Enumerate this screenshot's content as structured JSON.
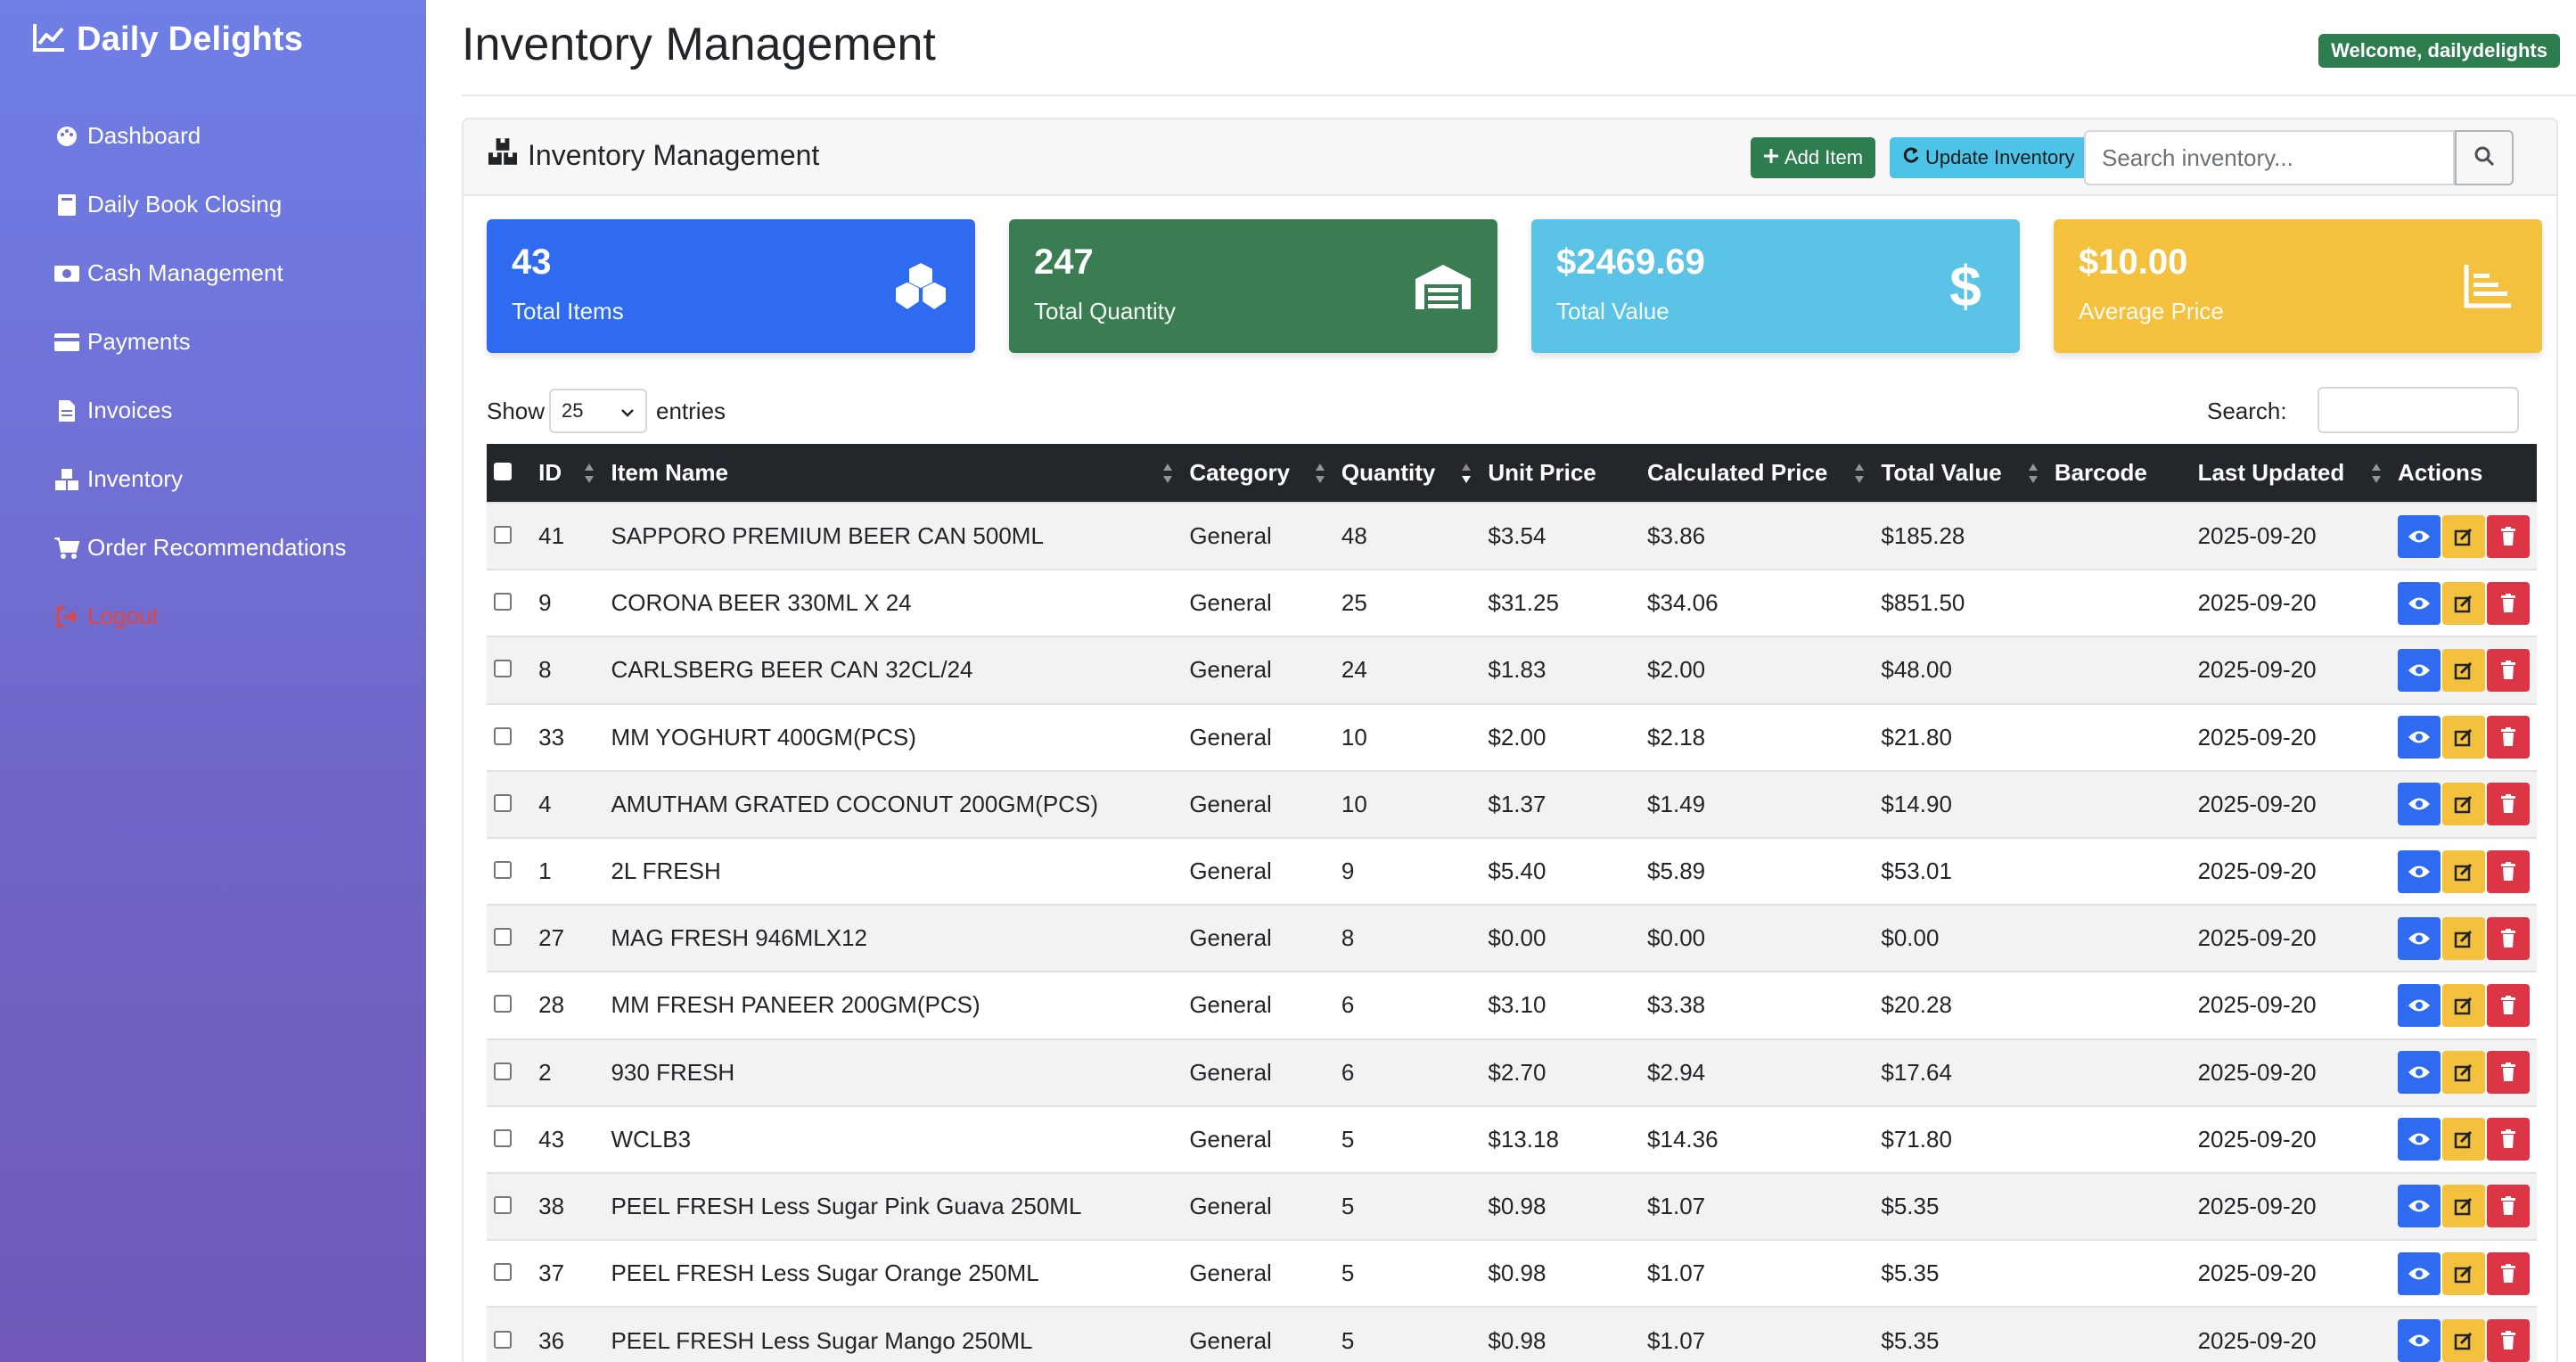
{
  "sidebar": {
    "brand": "Daily Delights",
    "items": [
      {
        "label": "Dashboard",
        "icon": "palette-icon"
      },
      {
        "label": "Daily Book Closing",
        "icon": "book-icon"
      },
      {
        "label": "Cash Management",
        "icon": "money-icon"
      },
      {
        "label": "Payments",
        "icon": "credit-card-icon"
      },
      {
        "label": "Invoices",
        "icon": "invoice-icon"
      },
      {
        "label": "Inventory",
        "icon": "boxes-icon"
      },
      {
        "label": "Order Recommendations",
        "icon": "cart-icon"
      },
      {
        "label": "Logout",
        "icon": "logout-icon"
      }
    ]
  },
  "header": {
    "title": "Inventory Management",
    "welcome": "Welcome, dailydelights"
  },
  "card": {
    "title": "Inventory Management",
    "add_label": "Add Item",
    "update_label": "Update Inventory",
    "search_placeholder": "Search inventory..."
  },
  "stats": [
    {
      "value": "43",
      "label": "Total Items",
      "color": "#2f6bf0",
      "icon": "boxes-icon"
    },
    {
      "value": "247",
      "label": "Total Quantity",
      "color": "#3b7d52",
      "icon": "warehouse-icon"
    },
    {
      "value": "$2469.69",
      "label": "Total Value",
      "color": "#5bc3e6",
      "icon": "dollar-icon"
    },
    {
      "value": "$10.00",
      "label": "Average Price",
      "color": "#f4c13e",
      "icon": "chart-icon"
    }
  ],
  "datatable": {
    "show_label": "Show",
    "entries_value": "25",
    "entries_label": "entries",
    "search_label": "Search:"
  },
  "table": {
    "columns": [
      "ID",
      "Item Name",
      "Category",
      "Quantity",
      "Unit Price",
      "Calculated Price",
      "Total Value",
      "Barcode",
      "Last Updated",
      "Actions"
    ],
    "rows": [
      {
        "id": "41",
        "name": "SAPPORO PREMIUM BEER CAN 500ML",
        "category": "General",
        "qty": "48",
        "unit": "$3.54",
        "calc": "$3.86",
        "total": "$185.28",
        "barcode": "",
        "updated": "2025-09-20"
      },
      {
        "id": "9",
        "name": "CORONA BEER 330ML X 24",
        "category": "General",
        "qty": "25",
        "unit": "$31.25",
        "calc": "$34.06",
        "total": "$851.50",
        "barcode": "",
        "updated": "2025-09-20"
      },
      {
        "id": "8",
        "name": "CARLSBERG BEER CAN 32CL/24",
        "category": "General",
        "qty": "24",
        "unit": "$1.83",
        "calc": "$2.00",
        "total": "$48.00",
        "barcode": "",
        "updated": "2025-09-20"
      },
      {
        "id": "33",
        "name": "MM YOGHURT 400GM(PCS)",
        "category": "General",
        "qty": "10",
        "unit": "$2.00",
        "calc": "$2.18",
        "total": "$21.80",
        "barcode": "",
        "updated": "2025-09-20"
      },
      {
        "id": "4",
        "name": "AMUTHAM GRATED COCONUT 200GM(PCS)",
        "category": "General",
        "qty": "10",
        "unit": "$1.37",
        "calc": "$1.49",
        "total": "$14.90",
        "barcode": "",
        "updated": "2025-09-20"
      },
      {
        "id": "1",
        "name": "2L FRESH",
        "category": "General",
        "qty": "9",
        "unit": "$5.40",
        "calc": "$5.89",
        "total": "$53.01",
        "barcode": "",
        "updated": "2025-09-20"
      },
      {
        "id": "27",
        "name": "MAG FRESH 946MLX12",
        "category": "General",
        "qty": "8",
        "unit": "$0.00",
        "calc": "$0.00",
        "total": "$0.00",
        "barcode": "",
        "updated": "2025-09-20"
      },
      {
        "id": "28",
        "name": "MM FRESH PANEER 200GM(PCS)",
        "category": "General",
        "qty": "6",
        "unit": "$3.10",
        "calc": "$3.38",
        "total": "$20.28",
        "barcode": "",
        "updated": "2025-09-20"
      },
      {
        "id": "2",
        "name": "930 FRESH",
        "category": "General",
        "qty": "6",
        "unit": "$2.70",
        "calc": "$2.94",
        "total": "$17.64",
        "barcode": "",
        "updated": "2025-09-20"
      },
      {
        "id": "43",
        "name": "WCLB3",
        "category": "General",
        "qty": "5",
        "unit": "$13.18",
        "calc": "$14.36",
        "total": "$71.80",
        "barcode": "",
        "updated": "2025-09-20"
      },
      {
        "id": "38",
        "name": "PEEL FRESH Less Sugar Pink Guava 250ML",
        "category": "General",
        "qty": "5",
        "unit": "$0.98",
        "calc": "$1.07",
        "total": "$5.35",
        "barcode": "",
        "updated": "2025-09-20"
      },
      {
        "id": "37",
        "name": "PEEL FRESH Less Sugar Orange 250ML",
        "category": "General",
        "qty": "5",
        "unit": "$0.98",
        "calc": "$1.07",
        "total": "$5.35",
        "barcode": "",
        "updated": "2025-09-20"
      },
      {
        "id": "36",
        "name": "PEEL FRESH Less Sugar Mango 250ML",
        "category": "General",
        "qty": "5",
        "unit": "$0.98",
        "calc": "$1.07",
        "total": "$5.35",
        "barcode": "",
        "updated": "2025-09-20"
      }
    ]
  }
}
